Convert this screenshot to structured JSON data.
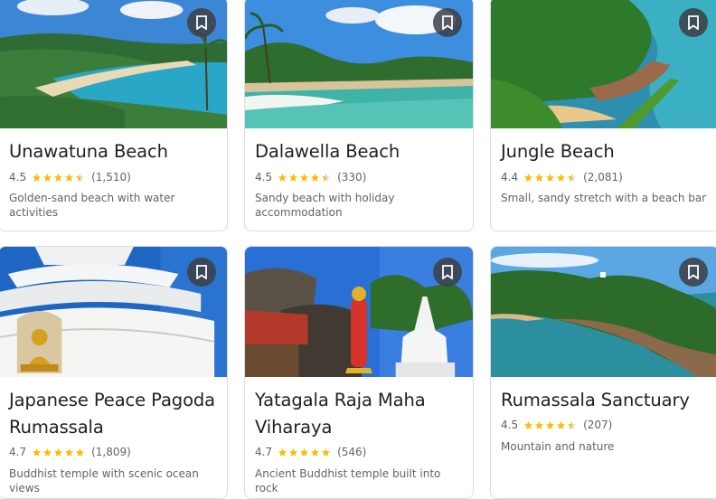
{
  "places": [
    {
      "title": "Unawatuna Beach",
      "rating": "4.5",
      "stars": 4.5,
      "reviews": "(1,510)",
      "description": "Golden-sand beach with water activities",
      "photo": "unawatuna-beach-photo"
    },
    {
      "title": "Dalawella Beach",
      "rating": "4.5",
      "stars": 4.5,
      "reviews": "(330)",
      "description": "Sandy beach with holiday accommodation",
      "photo": "dalawella-beach-photo"
    },
    {
      "title": "Jungle Beach",
      "rating": "4.4",
      "stars": 4.5,
      "reviews": "(2,081)",
      "description": "Small, sandy stretch with a beach bar",
      "photo": "jungle-beach-photo"
    },
    {
      "title": "Japanese Peace Pagoda Rumassala",
      "title_line1": "Japanese Peace Pagoda",
      "title_line2": "Rumassala",
      "rating": "4.7",
      "stars": 5,
      "reviews": "(1,809)",
      "description": "Buddhist temple with scenic ocean views",
      "photo": "peace-pagoda-photo"
    },
    {
      "title": "Yatagala Raja Maha Viharaya",
      "title_line1": "Yatagala Raja Maha",
      "title_line2": "Viharaya",
      "rating": "4.7",
      "stars": 5,
      "reviews": "(546)",
      "description": "Ancient Buddhist temple built into rock",
      "photo": "yatagala-temple-photo"
    },
    {
      "title": "Rumassala Sanctuary",
      "rating": "4.5",
      "stars": 4.5,
      "reviews": "(207)",
      "description": "Mountain and nature",
      "photo": "rumassala-sanctuary-photo"
    }
  ],
  "icons": {
    "save": "bookmark-icon",
    "star": "star-icon"
  },
  "colors": {
    "star": "#fbbc04",
    "star_empty": "#dadce0",
    "bookmark_bg": "#3c4043"
  }
}
